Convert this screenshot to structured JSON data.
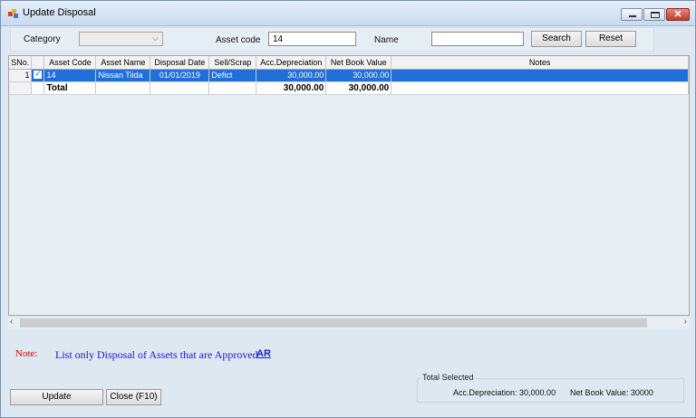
{
  "window": {
    "title": "Update Disposal"
  },
  "filter": {
    "category_label": "Category",
    "category_value": "",
    "asset_code_label": "Asset code",
    "asset_code_value": "14",
    "name_label": "Name",
    "name_value": "",
    "search_label": "Search",
    "reset_label": "Reset"
  },
  "grid": {
    "columns": [
      "SNo.",
      "",
      "Asset Code",
      "Asset Name",
      "Disposal Date",
      "Sell/Scrap",
      "Acc.Depreciation",
      "Net Book Value",
      "Notes"
    ],
    "rows": [
      {
        "sno": "1",
        "checked": true,
        "asset_code": "14",
        "asset_name": "Nissan Tiida",
        "disposal_date": "01/01/2019",
        "sell_scrap": "Defict",
        "acc_depreciation": "30,000.00",
        "net_book_value": "30,000.00",
        "notes": ""
      }
    ],
    "total": {
      "label": "Total",
      "acc_depreciation": "30,000.00",
      "net_book_value": "30,000.00"
    }
  },
  "note": {
    "label": "Note:",
    "text": "List only Disposal of Assets that are Approved.",
    "link": "AR"
  },
  "totals_selected": {
    "legend": "Total Selected",
    "acc_depreciation": "Acc.Depreciation: 30,000.00",
    "net_book_value": "Net Book Value: 30000"
  },
  "buttons": {
    "update_label": "Update",
    "close_label": "Close (F10)"
  },
  "colors": {
    "selection": "#1e6fd9",
    "note_label": "#e00000",
    "note_text": "#1a1acc"
  }
}
